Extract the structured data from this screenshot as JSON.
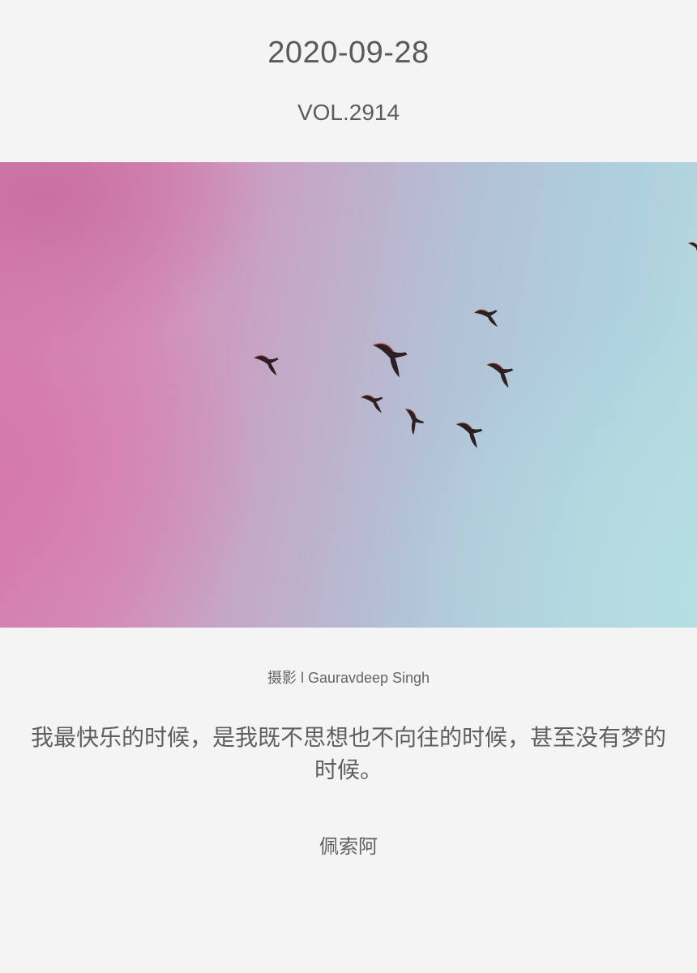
{
  "header": {
    "date": "2020-09-28",
    "volume": "VOL.2914"
  },
  "photo": {
    "subject": "flock of birds flying in pink and blue sky",
    "icon": "photo-image"
  },
  "caption": {
    "text": "摄影 l Gauravdeep Singh"
  },
  "quote": {
    "text": "我最快乐的时候，是我既不思想也不向往的时候，甚至没有梦的时候。"
  },
  "author": {
    "name": "佩索阿"
  }
}
